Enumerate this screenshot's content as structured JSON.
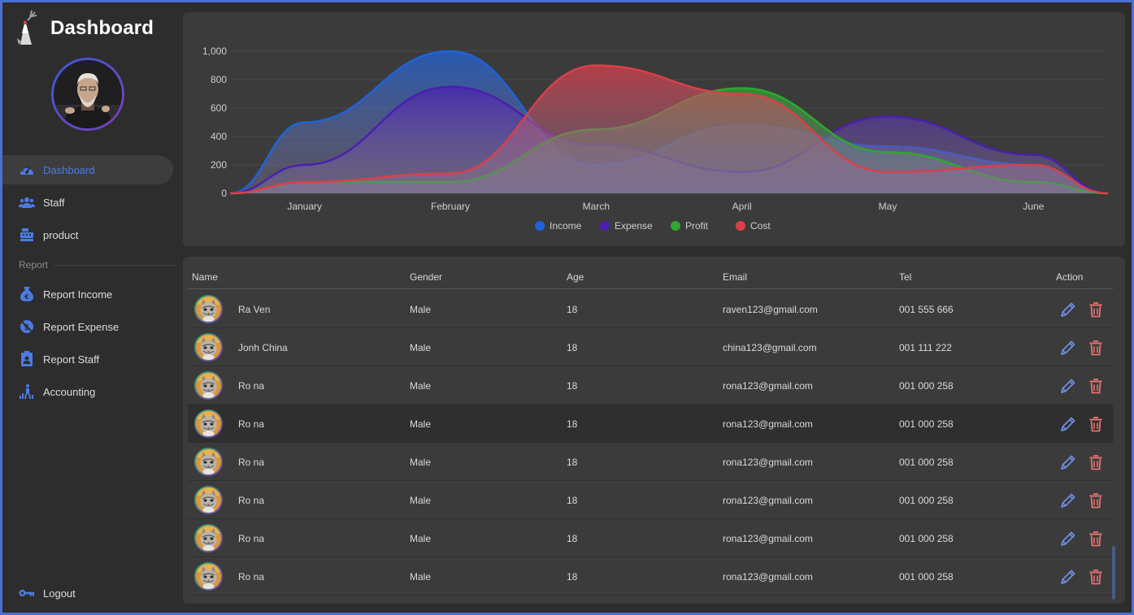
{
  "app": {
    "title": "Dashboard",
    "accent_color": "#4c7be3"
  },
  "sidebar": {
    "items": [
      {
        "label": "Dashboard",
        "icon": "speedometer-icon",
        "active": true
      },
      {
        "label": "Staff",
        "icon": "people-icon"
      },
      {
        "label": "product",
        "icon": "cash-register-icon"
      }
    ],
    "section_label": "Report",
    "report_items": [
      {
        "label": "Report Income",
        "icon": "money-bag-icon"
      },
      {
        "label": "Report Expense",
        "icon": "no-money-icon"
      },
      {
        "label": "Report Staff",
        "icon": "id-badge-icon"
      },
      {
        "label": "Accounting",
        "icon": "accounting-chart-icon"
      }
    ],
    "logout_label": "Logout"
  },
  "chart_data": {
    "type": "area",
    "categories": [
      "January",
      "February",
      "March",
      "April",
      "May",
      "June"
    ],
    "ylim": [
      0,
      1000
    ],
    "yticks": [
      "0",
      "200",
      "400",
      "600",
      "800",
      "1,000"
    ],
    "grid": true,
    "legend_position": "bottom",
    "series": [
      {
        "name": "Income",
        "color": "#1f63d8",
        "values": [
          500,
          1000,
          200,
          480,
          330,
          200
        ]
      },
      {
        "name": "Expense",
        "color": "#4a1fb0",
        "values": [
          200,
          750,
          340,
          150,
          540,
          270
        ]
      },
      {
        "name": "Profit",
        "color": "#2ea82e",
        "values": [
          80,
          80,
          450,
          740,
          290,
          80
        ]
      },
      {
        "name": "Cost",
        "color": "#d9404a",
        "values": [
          80,
          140,
          900,
          700,
          150,
          200
        ]
      }
    ]
  },
  "table": {
    "columns": [
      "Name",
      "Gender",
      "Age",
      "Email",
      "Tel",
      "Action"
    ],
    "rows": [
      {
        "name": "Ra Ven",
        "gender": "Male",
        "age": "18",
        "email": "raven123@gmail.com",
        "tel": "001 555 666"
      },
      {
        "name": "Jonh China",
        "gender": "Male",
        "age": "18",
        "email": "china123@gmail.com",
        "tel": "001 111 222"
      },
      {
        "name": "Ro na",
        "gender": "Male",
        "age": "18",
        "email": "rona123@gmail.com",
        "tel": "001 000 258"
      },
      {
        "name": "Ro na",
        "gender": "Male",
        "age": "18",
        "email": "rona123@gmail.com",
        "tel": "001 000 258"
      },
      {
        "name": "Ro na",
        "gender": "Male",
        "age": "18",
        "email": "rona123@gmail.com",
        "tel": "001 000 258"
      },
      {
        "name": "Ro na",
        "gender": "Male",
        "age": "18",
        "email": "rona123@gmail.com",
        "tel": "001 000 258"
      },
      {
        "name": "Ro na",
        "gender": "Male",
        "age": "18",
        "email": "rona123@gmail.com",
        "tel": "001 000 258"
      },
      {
        "name": "Ro na",
        "gender": "Male",
        "age": "18",
        "email": "rona123@gmail.com",
        "tel": "001 000 258"
      }
    ],
    "highlighted_row": 3,
    "edit_icon": "pencil-icon",
    "delete_icon": "trash-icon",
    "edit_color": "#6f8fe0",
    "delete_color": "#e8736e"
  }
}
